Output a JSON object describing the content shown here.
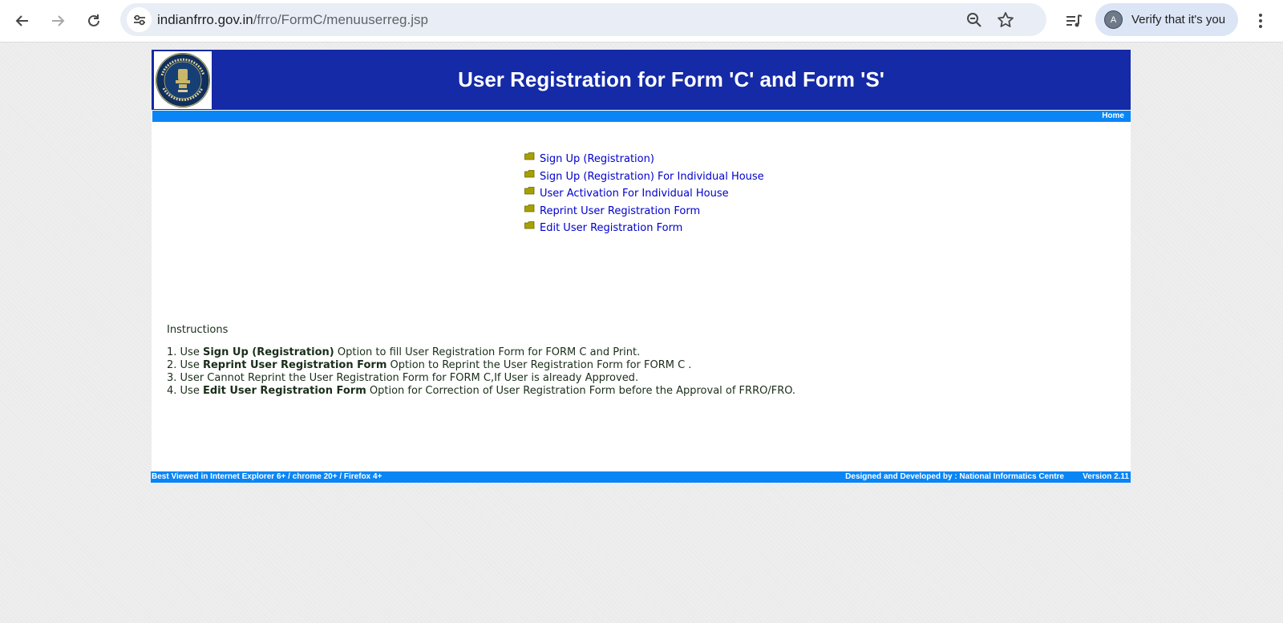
{
  "browser": {
    "url_host": "indianfrro.gov.in",
    "url_path": "/frro/FormC/menuuserreg.jsp",
    "profile_label": "Verify that it's you",
    "profile_initial": "A",
    "icons": [
      "back-arrow-icon",
      "forward-arrow-icon",
      "reload-icon",
      "site-info-icon",
      "zoom-out-icon",
      "bookmark-star-icon",
      "media-playlist-icon",
      "more-menu-icon"
    ]
  },
  "header": {
    "title": "User Registration for Form 'C' and Form 'S'",
    "logo": "emblem-seal-icon",
    "logo_lettering": "BUREAU OF IMMIGRATION · MINISTRY OF HOME AFFAIRS · INDIA"
  },
  "nav": {
    "home_label": "Home"
  },
  "menu": [
    {
      "label": "Sign Up (Registration)"
    },
    {
      "label": "Sign Up (Registration) For Individual House"
    },
    {
      "label": "User Activation For Individual House"
    },
    {
      "label": "Reprint User Registration Form"
    },
    {
      "label": "Edit User Registration Form"
    }
  ],
  "instructions": {
    "heading": "Instructions",
    "items": [
      {
        "num": "1.",
        "pre": "Use",
        "bold": "Sign Up (Registration)",
        "post": "Option to fill User Registration Form for FORM C and Print."
      },
      {
        "num": "2.",
        "pre": "Use",
        "bold": "Reprint User Registration Form",
        "post": "Option to Reprint the User Registration Form for FORM C ."
      },
      {
        "num": "3.",
        "text": "User Cannot Reprint the User Registration Form for FORM C,If User is already Approved."
      },
      {
        "num": "4.",
        "pre": "Use",
        "bold": "Edit User Registration Form",
        "post": "Option for Correction of User Registration Form before the Approval of FRRO/FRO."
      }
    ]
  },
  "footer": {
    "left": "Best Viewed in Internet Explorer 6+ / chrome 20+ / Firefox 4+",
    "right": "Designed and Developed by : National Informatics Centre",
    "version": "Version 2.11"
  },
  "colors": {
    "banner": "#142aa6",
    "nav_bar": "#0a85f5",
    "link": "#0000cc",
    "bullet": "#a8a000"
  }
}
